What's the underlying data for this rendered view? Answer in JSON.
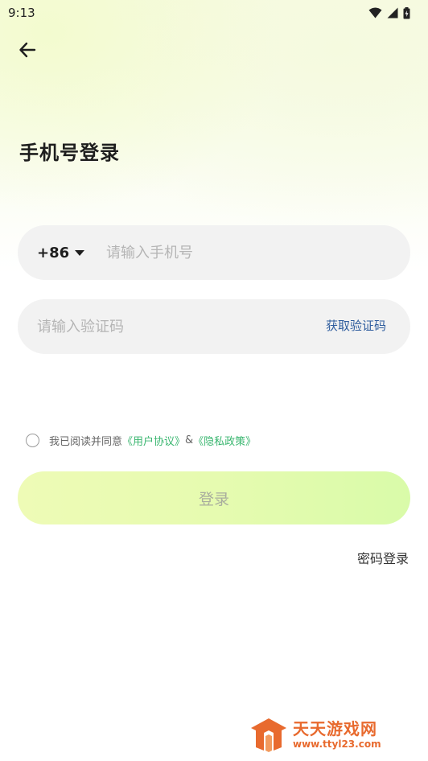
{
  "status_bar": {
    "time": "9:13",
    "icons": [
      "wifi-icon",
      "signal-icon",
      "battery-icon"
    ]
  },
  "header": {
    "back_icon": "arrow-left-icon",
    "title": "手机号登录"
  },
  "phone_field": {
    "country_code": "+86",
    "dropdown_icon": "caret-down-icon",
    "placeholder": "请输入手机号",
    "value": ""
  },
  "code_field": {
    "placeholder": "请输入验证码",
    "value": "",
    "get_code_label": "获取验证码"
  },
  "agreement": {
    "checked": false,
    "prefix": "我已阅读并同意",
    "user_agreement": "《用户协议》",
    "connector": "&",
    "privacy_policy": "《隐私政策》"
  },
  "login_button": {
    "label": "登录"
  },
  "alt_login": {
    "label": "密码登录"
  },
  "watermark": {
    "main": "天天游戏网",
    "url": "www.ttyl23.com"
  },
  "colors": {
    "accent_green": "#39b66f",
    "link_blue": "#2f5d9e",
    "button_gradient_start": "#eefbb6",
    "button_gradient_end": "#d9fba9",
    "watermark_orange": "#e86a2e"
  }
}
